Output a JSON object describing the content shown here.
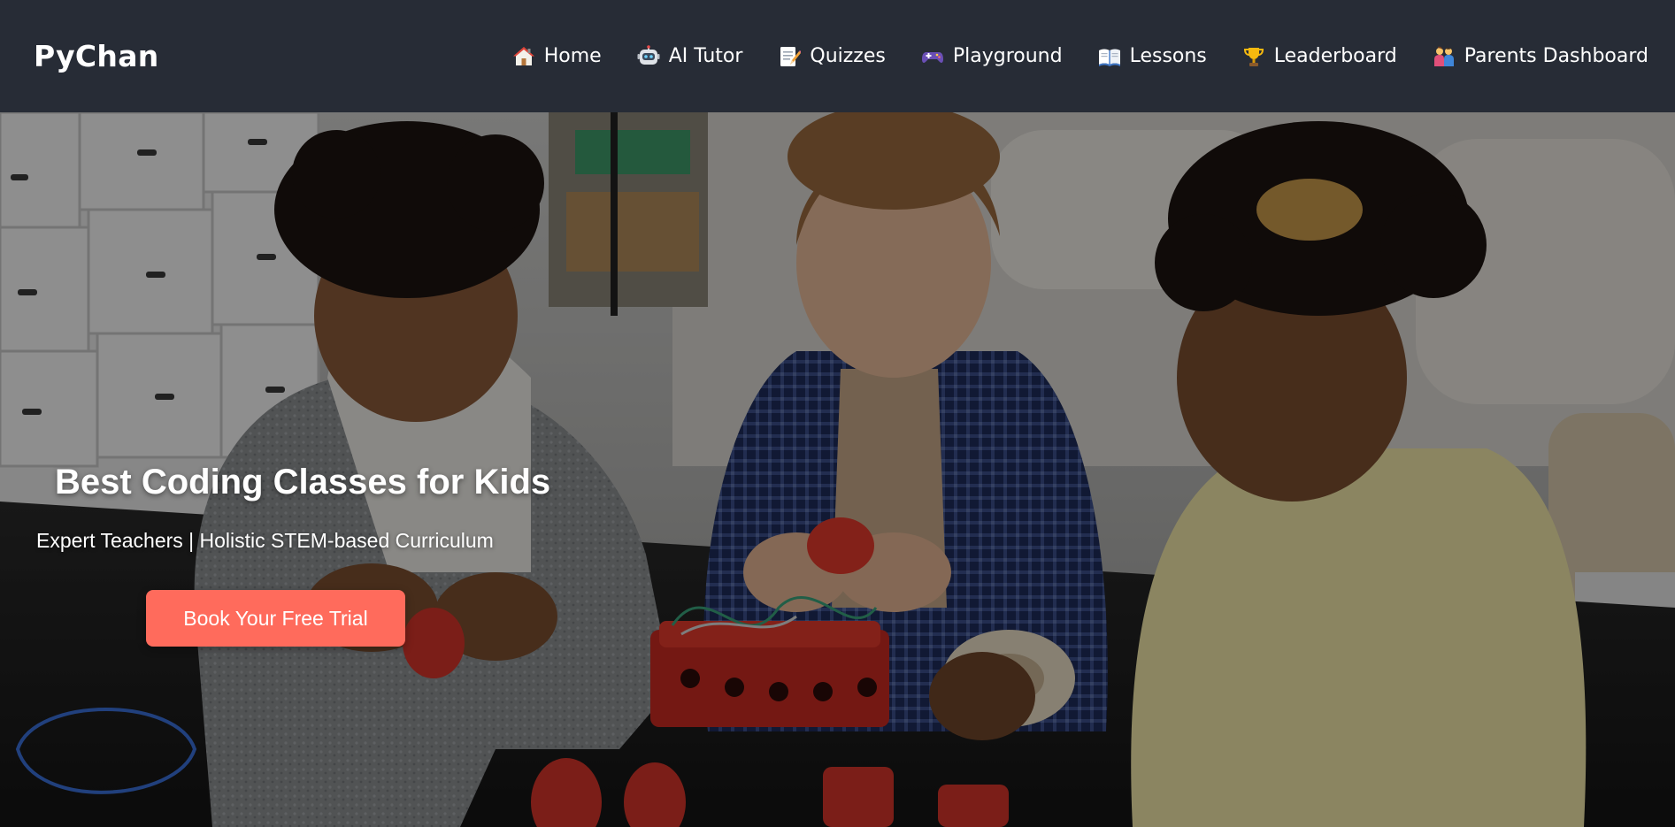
{
  "brand": {
    "name": "PyChan"
  },
  "nav": {
    "items": [
      {
        "label": "Home",
        "icon": "house-icon"
      },
      {
        "label": "AI Tutor",
        "icon": "robot-icon"
      },
      {
        "label": "Quizzes",
        "icon": "memo-icon"
      },
      {
        "label": "Playground",
        "icon": "game-controller-icon"
      },
      {
        "label": "Lessons",
        "icon": "open-book-icon"
      },
      {
        "label": "Leaderboard",
        "icon": "trophy-icon"
      },
      {
        "label": "Parents Dashboard",
        "icon": "family-icon"
      }
    ]
  },
  "hero": {
    "title": "Best Coding Classes for Kids",
    "subtitle": "Expert Teachers | Holistic STEM-based Curriculum",
    "cta_label": "Book Your Free Trial"
  },
  "colors": {
    "header_bg": "#272c36",
    "cta_bg": "#ff6b5c",
    "text": "#ffffff"
  }
}
